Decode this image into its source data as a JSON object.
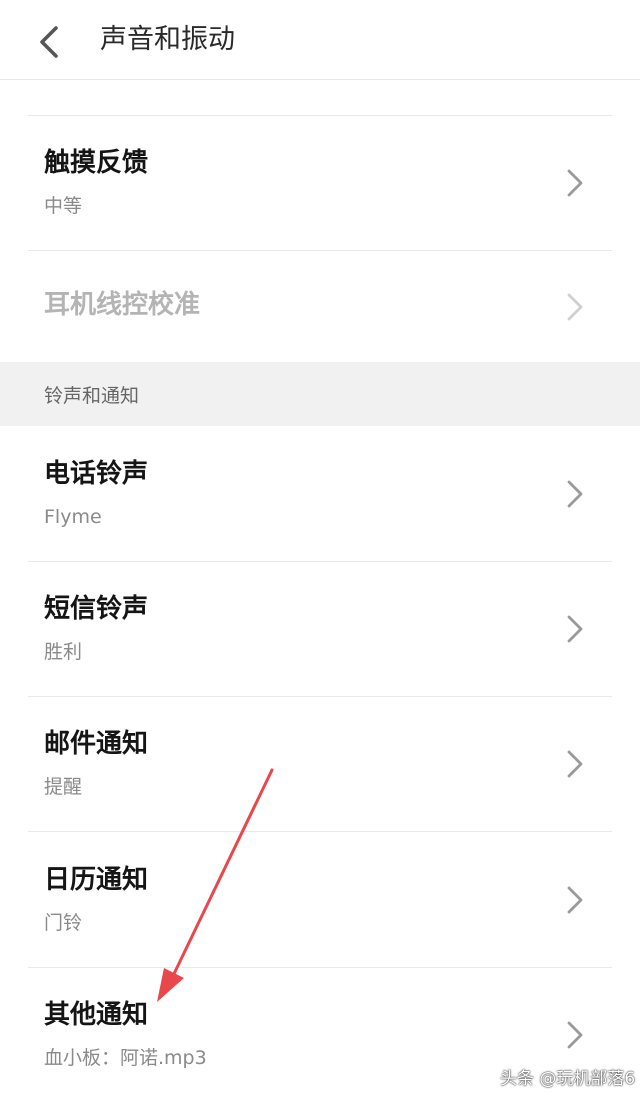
{
  "header": {
    "title": "声音和振动",
    "back_icon": "chevron-left-icon"
  },
  "rows_top": [
    {
      "title": "触摸反馈",
      "subtitle": "中等",
      "enabled": true
    },
    {
      "title": "耳机线控校准",
      "subtitle": "",
      "enabled": false
    }
  ],
  "section": {
    "label": "铃声和通知"
  },
  "rows_ringtones": [
    {
      "title": "电话铃声",
      "subtitle": "Flyme"
    },
    {
      "title": "短信铃声",
      "subtitle": "胜利"
    },
    {
      "title": "邮件通知",
      "subtitle": "提醒"
    },
    {
      "title": "日历通知",
      "subtitle": "门铃"
    },
    {
      "title": "其他通知",
      "subtitle": "血小板：阿诺.mp3"
    }
  ],
  "annotation": {
    "arrow_color": "#e8474b"
  },
  "watermark": {
    "text": "头条 @玩机部落6"
  },
  "colors": {
    "chevron": "#9a9a9a",
    "chevron_disabled": "#d0d0d0",
    "section_bg": "#f1f1f1"
  }
}
